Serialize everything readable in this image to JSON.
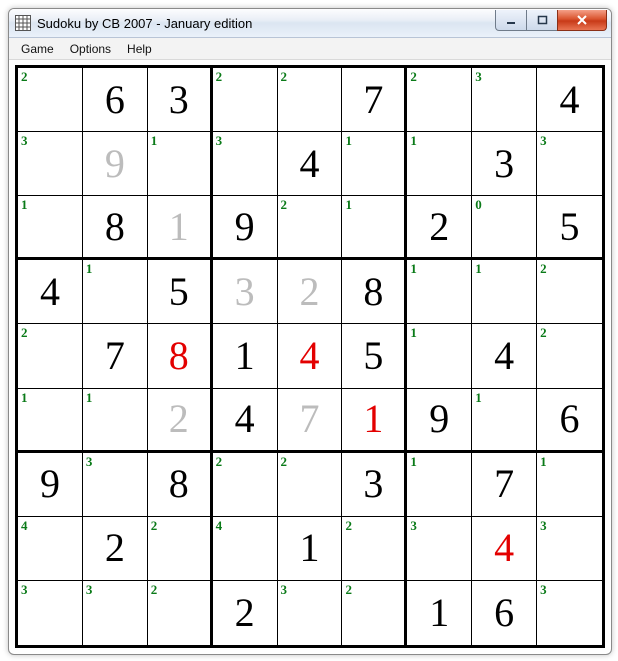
{
  "window": {
    "title": "Sudoku by CB 2007 - January edition"
  },
  "menu": {
    "items": [
      "Game",
      "Options",
      "Help"
    ]
  },
  "icons": {
    "app": "grid-icon",
    "minimize": "minimize-icon",
    "maximize": "maximize-icon",
    "close": "close-icon"
  },
  "colors": {
    "hint": "#0a7a18",
    "given": "#000000",
    "error": "#e30000",
    "ghost": "#bcbcbc"
  },
  "board": {
    "rows": 9,
    "cols": 9,
    "cells": [
      [
        {
          "hint": "2"
        },
        {
          "val": "6",
          "style": "given"
        },
        {
          "val": "3",
          "style": "given"
        },
        {
          "hint": "2"
        },
        {
          "hint": "2"
        },
        {
          "val": "7",
          "style": "given"
        },
        {
          "hint": "2"
        },
        {
          "hint": "3"
        },
        {
          "val": "4",
          "style": "given"
        }
      ],
      [
        {
          "hint": "3"
        },
        {
          "val": "9",
          "style": "ghost"
        },
        {
          "hint": "1"
        },
        {
          "hint": "3"
        },
        {
          "val": "4",
          "style": "given"
        },
        {
          "hint": "1"
        },
        {
          "hint": "1"
        },
        {
          "val": "3",
          "style": "given"
        },
        {
          "hint": "3"
        }
      ],
      [
        {
          "hint": "1"
        },
        {
          "val": "8",
          "style": "given"
        },
        {
          "val": "1",
          "style": "ghost"
        },
        {
          "val": "9",
          "style": "given"
        },
        {
          "hint": "2"
        },
        {
          "hint": "1"
        },
        {
          "val": "2",
          "style": "given"
        },
        {
          "hint": "0"
        },
        {
          "val": "5",
          "style": "given"
        }
      ],
      [
        {
          "val": "4",
          "style": "given"
        },
        {
          "hint": "1"
        },
        {
          "val": "5",
          "style": "given"
        },
        {
          "val": "3",
          "style": "ghost"
        },
        {
          "val": "2",
          "style": "ghost"
        },
        {
          "val": "8",
          "style": "given"
        },
        {
          "hint": "1"
        },
        {
          "hint": "1"
        },
        {
          "hint": "2"
        }
      ],
      [
        {
          "hint": "2"
        },
        {
          "val": "7",
          "style": "given"
        },
        {
          "val": "8",
          "style": "err"
        },
        {
          "val": "1",
          "style": "given"
        },
        {
          "val": "4",
          "style": "err"
        },
        {
          "val": "5",
          "style": "given"
        },
        {
          "hint": "1"
        },
        {
          "val": "4",
          "style": "given"
        },
        {
          "hint": "2"
        }
      ],
      [
        {
          "hint": "1"
        },
        {
          "hint": "1"
        },
        {
          "val": "2",
          "style": "ghost"
        },
        {
          "val": "4",
          "style": "given"
        },
        {
          "val": "7",
          "style": "ghost"
        },
        {
          "val": "1",
          "style": "err"
        },
        {
          "val": "9",
          "style": "given"
        },
        {
          "hint": "1"
        },
        {
          "val": "6",
          "style": "given"
        }
      ],
      [
        {
          "val": "9",
          "style": "given"
        },
        {
          "hint": "3"
        },
        {
          "val": "8",
          "style": "given"
        },
        {
          "hint": "2"
        },
        {
          "hint": "2"
        },
        {
          "val": "3",
          "style": "given"
        },
        {
          "hint": "1"
        },
        {
          "val": "7",
          "style": "given"
        },
        {
          "hint": "1"
        }
      ],
      [
        {
          "hint": "4"
        },
        {
          "val": "2",
          "style": "given"
        },
        {
          "hint": "2"
        },
        {
          "hint": "4"
        },
        {
          "val": "1",
          "style": "given"
        },
        {
          "hint": "2"
        },
        {
          "hint": "3"
        },
        {
          "val": "4",
          "style": "err"
        },
        {
          "hint": "3"
        }
      ],
      [
        {
          "hint": "3"
        },
        {
          "hint": "3"
        },
        {
          "hint": "2"
        },
        {
          "val": "2",
          "style": "given"
        },
        {
          "hint": "3"
        },
        {
          "hint": "2"
        },
        {
          "val": "1",
          "style": "given"
        },
        {
          "val": "6",
          "style": "given"
        },
        {
          "hint": "3"
        }
      ]
    ]
  }
}
